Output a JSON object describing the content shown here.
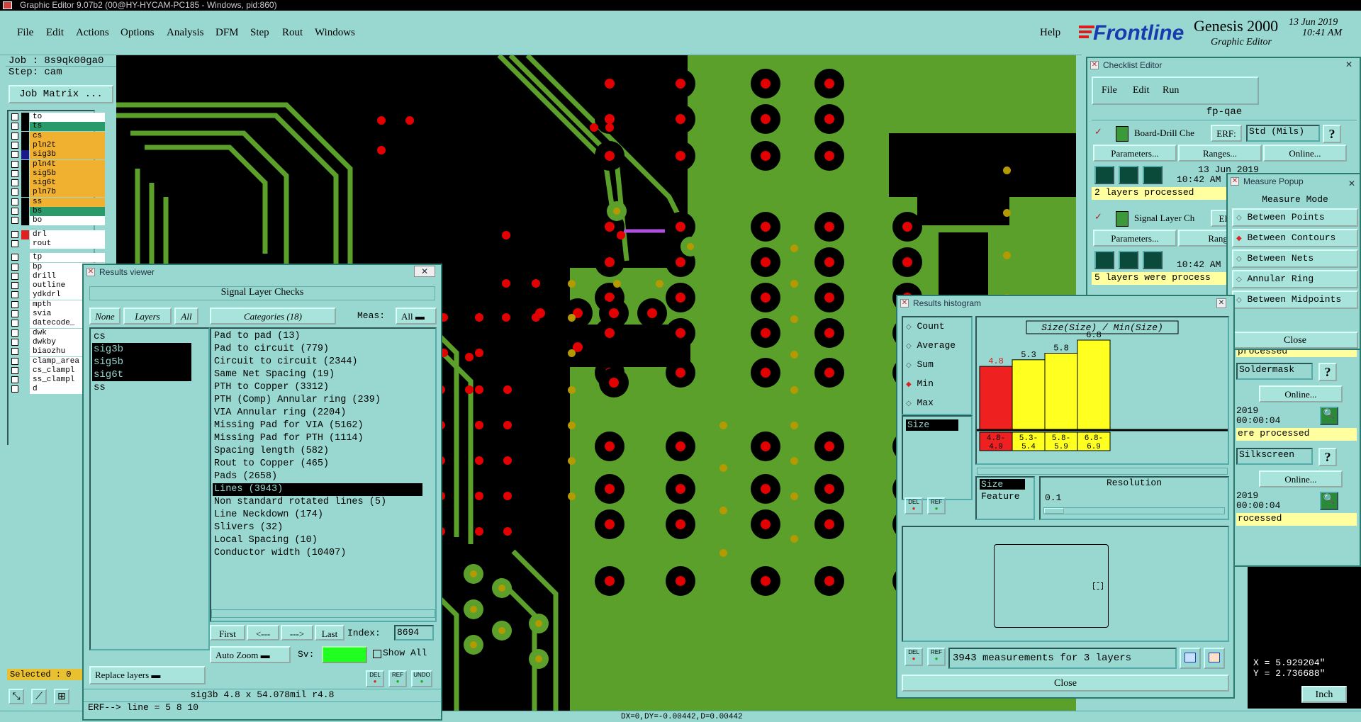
{
  "titlebar": {
    "text": "Graphic Editor 9.07b2 (00@HY-HYCAM-PC185 - Windows, pid:860)"
  },
  "menu": {
    "items": [
      "File",
      "Edit",
      "Actions",
      "Options",
      "Analysis",
      "DFM",
      "Step",
      "Rout",
      "Windows"
    ],
    "help": "Help"
  },
  "brand": {
    "logo": "Frontline",
    "product": "Genesis 2000",
    "subtitle": "Graphic Editor",
    "date": "13 Jun 2019",
    "time": "10:41 AM"
  },
  "job": {
    "job_label": "Job : 8s9qk00ga0",
    "step_label": "Step: cam",
    "matrix_button": "Job Matrix ..."
  },
  "layers": [
    {
      "name": "to",
      "color": "#ffffff",
      "check": "#000"
    },
    {
      "name": "ts",
      "color": "#2a9a6a",
      "check": "#000"
    },
    {
      "name": "cs",
      "color": "#f0b030",
      "check": "#000"
    },
    {
      "name": "pln2t",
      "color": "#f0b030",
      "check": "#000"
    },
    {
      "name": "sig3b",
      "color": "#f0b030",
      "check": "#1a1a8a"
    },
    {
      "name": "pln4t",
      "color": "#f0b030",
      "check": "#000"
    },
    {
      "name": "sig5b",
      "color": "#f0b030",
      "check": "#000"
    },
    {
      "name": "sig6t",
      "color": "#f0b030",
      "check": "#000"
    },
    {
      "name": "pln7b",
      "color": "#f0b030",
      "check": "#000"
    },
    {
      "name": "ss",
      "color": "#f0b030",
      "check": "#000"
    },
    {
      "name": "bs",
      "color": "#2a9a6a",
      "check": "#000"
    },
    {
      "name": "bo",
      "color": "#ffffff",
      "check": "#000"
    }
  ],
  "layers2": [
    "drl",
    "rout"
  ],
  "layers3": [
    "tp",
    "bp",
    "drill",
    "outline",
    "ydkdrl",
    "mpth",
    "svia",
    "datecode_",
    "dwk",
    "dwkby",
    "biaozhu",
    "clamp_area",
    "cs_clampl",
    "ss_clampl",
    "d"
  ],
  "status": {
    "selected": "Selected : 0",
    "coord_x": "X = 5.929204\"",
    "coord_y": "Y = 2.736688\"",
    "units": "Inch",
    "dxdy": "DX=0,DY=-0.00442,D=0.00442"
  },
  "results_viewer": {
    "title": "Results viewer",
    "header": "Signal Layer Checks",
    "none": "None",
    "layers": "Layers",
    "all": "All",
    "categories_label": "Categories (18)",
    "meas_label": "Meas:",
    "meas_value": "All",
    "layer_list": [
      "cs",
      "sig3b",
      "sig5b",
      "sig6t",
      "ss"
    ],
    "categories": [
      "Pad to pad (13)",
      "Pad to circuit (779)",
      "Circuit to circuit (2344)",
      "Same Net Spacing (19)",
      "PTH to Copper (3312)",
      "PTH (Comp) Annular ring (239)",
      "VIA Annular ring (2204)",
      "Missing Pad for VIA (5162)",
      "Missing Pad for PTH (1114)",
      "Spacing length (582)",
      "Rout to Copper (465)",
      "Pads (2658)",
      "Lines (3943)",
      "Non standard rotated lines (5)",
      "Line Neckdown (174)",
      "Slivers (32)",
      "Local Spacing (10)",
      "Conductor width (10407)"
    ],
    "first": "First",
    "prev": "<---",
    "next": "--->",
    "last": "Last",
    "index_label": "Index:",
    "index_value": "8694",
    "auto_zoom": "Auto Zoom",
    "sv": "Sv:",
    "show_all": "Show All",
    "replace": "Replace layers",
    "info": "sig3b 4.8 x 54.078mil  r4.8",
    "erf": "ERF--> line = 5 8 10",
    "del": "DEL",
    "ref": "REF",
    "undo": "UNDO"
  },
  "histogram": {
    "title": "Results histogram",
    "options": [
      "Count",
      "Average",
      "Sum",
      "Min",
      "Max"
    ],
    "selected_option": "Min",
    "field": "Size",
    "chart_title": "Size(Size) / Min(Size)",
    "size_label": "Size",
    "feature_label": "Feature",
    "resolution_label": "Resolution",
    "resolution_value": "0.1",
    "summary": "3943 measurements for 3 layers",
    "close": "Close",
    "del": "DEL",
    "ref": "REF"
  },
  "chart_data": {
    "type": "bar",
    "title": "Size(Size) / Min(Size)",
    "categories": [
      "4.8-4.9",
      "5.3-5.4",
      "5.8-5.9",
      "6.8-6.9"
    ],
    "category_labels": [
      "4.8- 4.9",
      "5.3- 5.4",
      "5.8- 5.9",
      "6.8- 6.9"
    ],
    "values": [
      4.8,
      5.3,
      5.8,
      6.8
    ],
    "colors": [
      "#ee2020",
      "#ffff20",
      "#ffff20",
      "#ffff20"
    ],
    "ylim": [
      0,
      6.8
    ]
  },
  "checklist": {
    "title": "Checklist Editor",
    "menu": [
      "File",
      "Edit",
      "Run"
    ],
    "name": "fp-qae",
    "items": [
      {
        "name": "Board-Drill Che",
        "erf": "ERF:",
        "erf_value": "Std (Mils)",
        "params": "Parameters...",
        "ranges": "Ranges...",
        "online": "Online...",
        "date": "13 Jun 2019",
        "time": "10:42 AM",
        "status": "2 layers processed"
      },
      {
        "name": "Signal Layer Ch",
        "erf": "ERI",
        "params": "Parameters...",
        "ranges": "Range",
        "date": "13 Jun",
        "time": "10:42 AM",
        "status": "5 layers were process"
      }
    ],
    "extra": [
      {
        "label": "Soldermask",
        "online": "Online...",
        "date": "2019",
        "time": "00:00:04",
        "status": "ere processed",
        "prev": "processed"
      },
      {
        "label": "Silkscreen",
        "online": "Online...",
        "date": "2019",
        "time": "00:00:04",
        "status": "rocessed"
      }
    ]
  },
  "measure": {
    "title": "Measure Popup",
    "mode": "Measure Mode",
    "options": [
      "Between Points",
      "Between Contours",
      "Between Nets",
      "Annular Ring",
      "Between Midpoints"
    ],
    "selected": "Between Contours",
    "close": "Close"
  }
}
